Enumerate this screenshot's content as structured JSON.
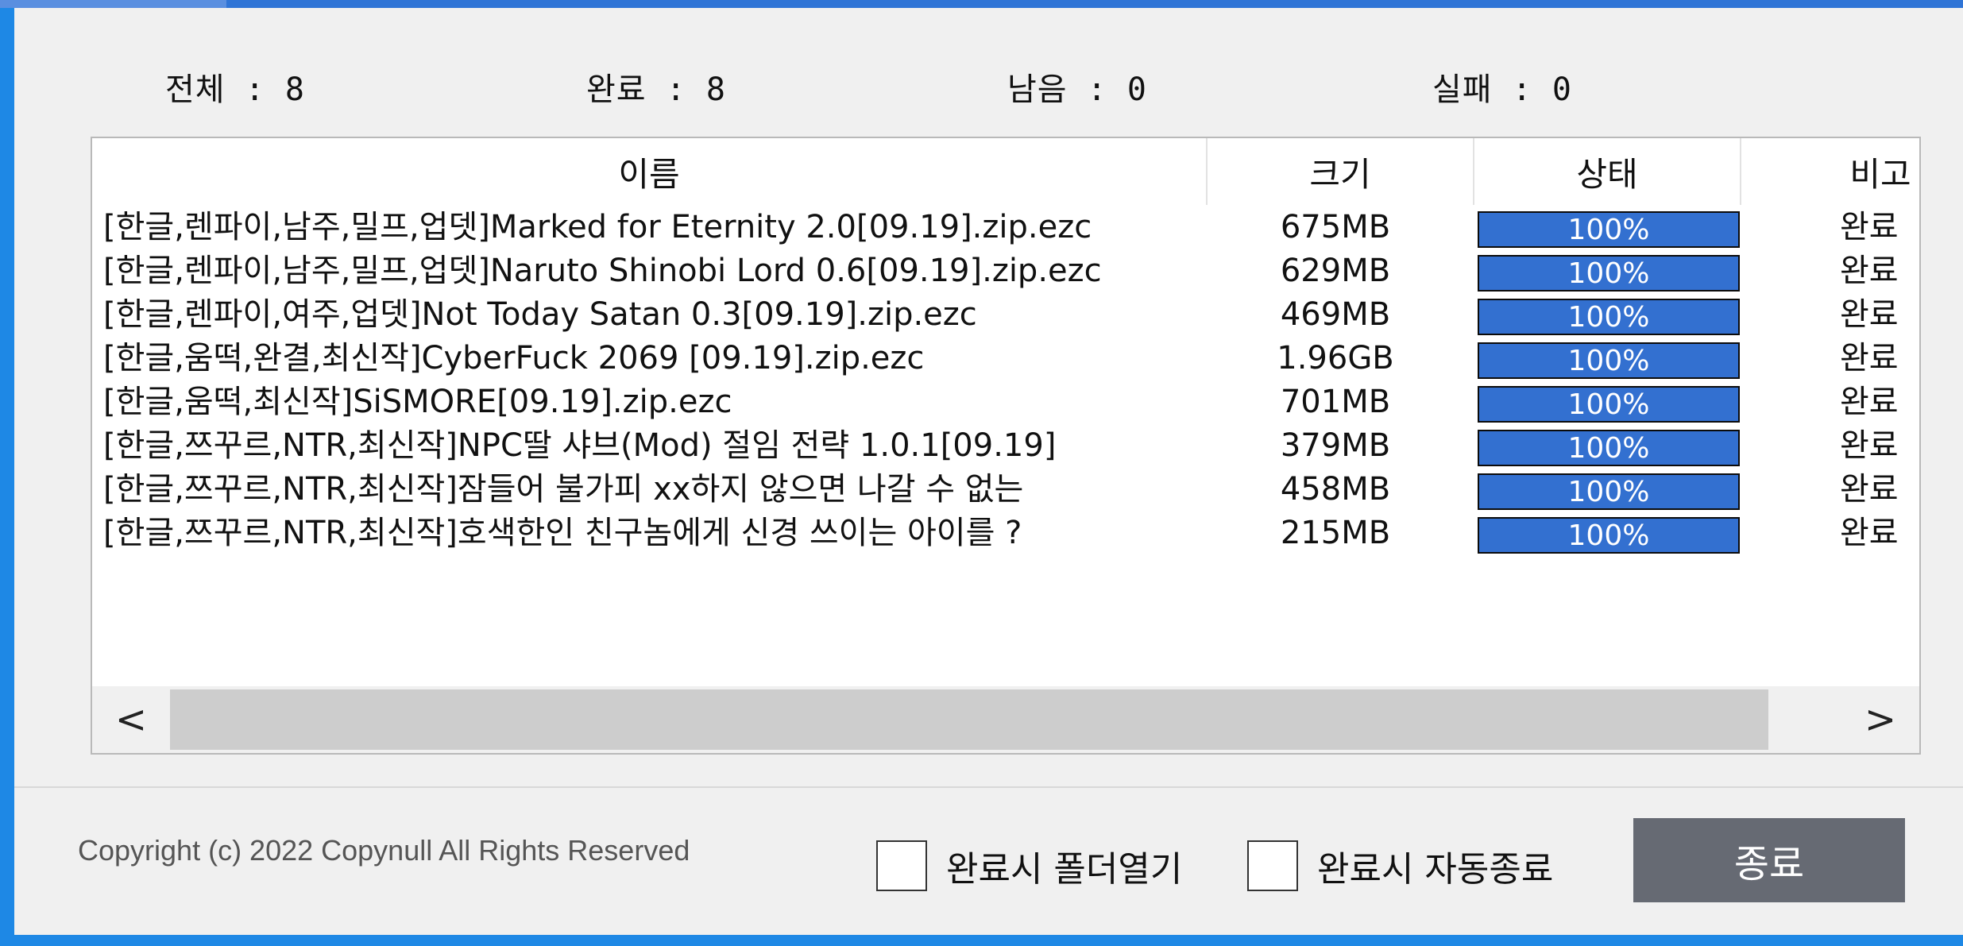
{
  "stats": {
    "total": "전체 : 8",
    "done": "완료 : 8",
    "remaining": "남음 : 0",
    "failed": "실패 : 0"
  },
  "table": {
    "columns": [
      "이름",
      "크기",
      "상태",
      "비고"
    ],
    "rows": [
      {
        "name": "[한글,렌파이,남주,밀프,업뎃]Marked for Eternity 2.0[09.19].zip.ezc",
        "size": "675MB",
        "progress": 100,
        "progress_label": "100%",
        "note": "완료"
      },
      {
        "name": "[한글,렌파이,남주,밀프,업뎃]Naruto Shinobi Lord 0.6[09.19].zip.ezc",
        "size": "629MB",
        "progress": 100,
        "progress_label": "100%",
        "note": "완료"
      },
      {
        "name": "[한글,렌파이,여주,업뎃]Not Today Satan 0.3[09.19].zip.ezc",
        "size": "469MB",
        "progress": 100,
        "progress_label": "100%",
        "note": "완료"
      },
      {
        "name": "[한글,움떡,완결,최신작]CyberFuck 2069 [09.19].zip.ezc",
        "size": "1.96GB",
        "progress": 100,
        "progress_label": "100%",
        "note": "완료"
      },
      {
        "name": "[한글,움떡,최신작]SiSMORE[09.19].zip.ezc",
        "size": "701MB",
        "progress": 100,
        "progress_label": "100%",
        "note": "완료"
      },
      {
        "name": "[한글,쯔꾸르,NTR,최신작]NPC딸 샤브(Mod) 절임 전략 1.0.1[09.19]",
        "size": "379MB",
        "progress": 100,
        "progress_label": "100%",
        "note": "완료"
      },
      {
        "name": "[한글,쯔꾸르,NTR,최신작]잠들어 불가피 xx하지 않으면 나갈 수 없는",
        "size": "458MB",
        "progress": 100,
        "progress_label": "100%",
        "note": "완료"
      },
      {
        "name": "[한글,쯔꾸르,NTR,최신작]호색한인 친구놈에게 신경 쓰이는 아이를 ?",
        "size": "215MB",
        "progress": 100,
        "progress_label": "100%",
        "note": "완료"
      }
    ]
  },
  "scrollbar": {
    "left_arrow": "<",
    "right_arrow": ">"
  },
  "footer": {
    "copyright": "Copyright (c) 2022 Copynull All Rights Reserved",
    "open_folder_label": "완료시 폴더열기",
    "auto_close_label": "완료시 자동종료",
    "close_button": "종료"
  },
  "colors": {
    "progress_fill": "#3370d0",
    "button_bg": "#666a73",
    "frame_accent": "#1e88e5"
  }
}
